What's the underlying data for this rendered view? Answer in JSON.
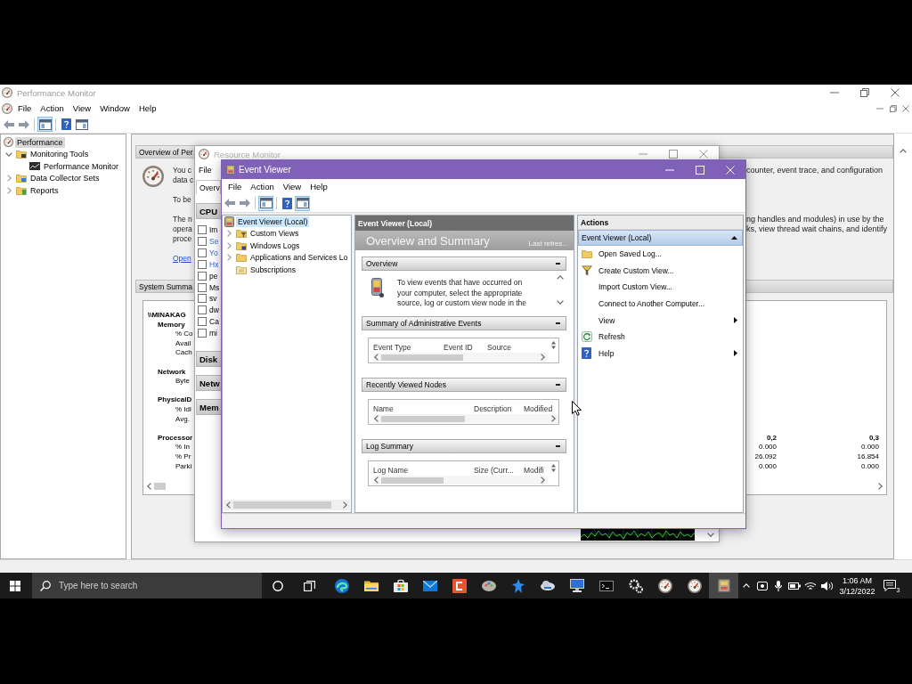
{
  "performance_monitor": {
    "title": "Performance Monitor",
    "menu": [
      "File",
      "Action",
      "View",
      "Window",
      "Help"
    ],
    "toolbar": [
      {
        "pressed": false
      },
      {
        "pressed": false
      },
      {
        "pressed": true
      },
      {
        "pressed": false
      },
      {
        "pressed": false
      }
    ],
    "tree": [
      {
        "label": "Performance",
        "selected": true,
        "children": [
          {
            "label": "Monitoring Tools",
            "selected": false,
            "expanded": true,
            "children": [
              {
                "label": "Performance Monitor",
                "selected": false
              }
            ]
          },
          {
            "label": "Data Collector Sets",
            "selected": false,
            "expanded": false
          },
          {
            "label": "Reports",
            "selected": false,
            "expanded": false
          }
        ]
      }
    ],
    "overview": {
      "header": "Overview of Per",
      "paragraphs": [
        {
          "left": [
            "You c",
            "data c"
          ],
          "right": [
            "counter, event trace, and configuration"
          ]
        },
        {
          "left": [
            "To be"
          ]
        },
        {
          "left": [
            "The n",
            "opera",
            "proce"
          ],
          "right": [
            "ng handles and modules) in use by the",
            "ks, view thread wait chains, and identify"
          ]
        }
      ],
      "link": "Open"
    },
    "system_summary": {
      "header": "System Summa",
      "computer": "\\\\MINAKAG",
      "groups": [
        {
          "name": "Memory",
          "counters": [
            {
              "label": "% Co"
            },
            {
              "label": "Avail"
            },
            {
              "label": "Cach"
            }
          ]
        },
        {
          "name": "Network",
          "counters": [
            {
              "label": "Byte"
            }
          ]
        },
        {
          "name": "PhysicalD",
          "counters": [
            {
              "label": "% Idl"
            },
            {
              "label": "Avg."
            }
          ]
        },
        {
          "name": "Processor",
          "instances": [
            "0,2",
            "0,3"
          ],
          "counters": [
            {
              "label": "% In",
              "values": [
                "0.000",
                "0.000"
              ]
            },
            {
              "label": "% Pr",
              "values": [
                "26.092",
                "16.854"
              ]
            },
            {
              "label": "Parki",
              "values": [
                "0.000",
                "0.000"
              ]
            }
          ]
        }
      ]
    }
  },
  "resource_monitor": {
    "title": "Resource Monitor",
    "menu": [
      "File"
    ],
    "tabs": [
      {
        "label": "Overv",
        "selected": true
      }
    ],
    "cpu": {
      "title": "CPU",
      "column_header": {
        "label": "Im",
        "checked": false
      },
      "processes": [
        {
          "name": "Se",
          "checked": false,
          "suspended": true
        },
        {
          "name": "Yo",
          "checked": false,
          "suspended": true
        },
        {
          "name": "Hx",
          "checked": false,
          "suspended": true
        },
        {
          "name": "pe",
          "checked": false,
          "suspended": false
        },
        {
          "name": "Ms",
          "checked": false,
          "suspended": false
        },
        {
          "name": "sv",
          "checked": false,
          "suspended": false
        },
        {
          "name": "dw",
          "checked": false,
          "suspended": false
        },
        {
          "name": "Ca",
          "checked": false,
          "suspended": false
        },
        {
          "name": "mi",
          "checked": false,
          "suspended": false
        }
      ]
    },
    "sections": [
      "Disk",
      "Netw",
      "Mem"
    ]
  },
  "event_viewer": {
    "title": "Event Viewer",
    "menu": [
      "File",
      "Action",
      "View",
      "Help"
    ],
    "toolbar": [
      {
        "pressed": false
      },
      {
        "pressed": false
      },
      {
        "pressed": true
      },
      {
        "pressed": false
      },
      {
        "pressed": true
      }
    ],
    "tree": [
      {
        "label": "Event Viewer (Local)",
        "selected": true,
        "children": [
          {
            "label": "Custom Views",
            "selected": false,
            "expanded": false
          },
          {
            "label": "Windows Logs",
            "selected": false,
            "expanded": false
          },
          {
            "label": "Applications and Services Lo",
            "selected": false,
            "expanded": false
          },
          {
            "label": "Subscriptions",
            "selected": false
          }
        ]
      }
    ],
    "center": {
      "header": "Event Viewer (Local)",
      "title": "Overview and Summary",
      "last_refreshed": "Last refres...",
      "sections": [
        {
          "title": "Overview",
          "kind": "text",
          "text": "To view events that have occurred on your computer, select the appropriate source, log or custom view node in the"
        },
        {
          "title": "Summary of Administrative Events",
          "kind": "table",
          "columns": [
            "Event Type",
            "Event ID",
            "Source"
          ],
          "vertical_scroll": true
        },
        {
          "title": "Recently Viewed Nodes",
          "kind": "table",
          "columns": [
            "Name",
            "Description",
            "Modified"
          ],
          "vertical_scroll": false
        },
        {
          "title": "Log Summary",
          "kind": "table",
          "columns": [
            "Log Name",
            "Size (Curr...",
            "Modifi"
          ],
          "vertical_scroll": true
        }
      ]
    },
    "actions": {
      "header": "Actions",
      "group": {
        "label": "Event Viewer (Local)",
        "expanded": true
      },
      "items": [
        {
          "label": "Open Saved Log...",
          "submenu": false
        },
        {
          "label": "Create Custom View...",
          "submenu": false
        },
        {
          "label": "Import Custom View...",
          "submenu": false
        },
        {
          "label": "Connect to Another Computer...",
          "submenu": false
        },
        {
          "label": "View",
          "submenu": true
        },
        {
          "label": "Refresh",
          "submenu": false
        },
        {
          "label": "Help",
          "submenu": true
        }
      ]
    }
  },
  "taskbar": {
    "search": {
      "placeholder": "Type here to search"
    },
    "apps": [
      {
        "selected": false
      },
      {
        "selected": false
      },
      {
        "selected": false
      },
      {
        "selected": false
      },
      {
        "selected": false
      },
      {
        "selected": false
      },
      {
        "selected": false
      },
      {
        "selected": false
      },
      {
        "selected": false
      },
      {
        "selected": false
      },
      {
        "selected": false
      },
      {
        "selected": false
      },
      {
        "selected": false
      },
      {
        "selected": true
      }
    ],
    "clock": {
      "time": "1:06 AM",
      "date": "3/12/2022"
    },
    "notification_count": "3"
  }
}
